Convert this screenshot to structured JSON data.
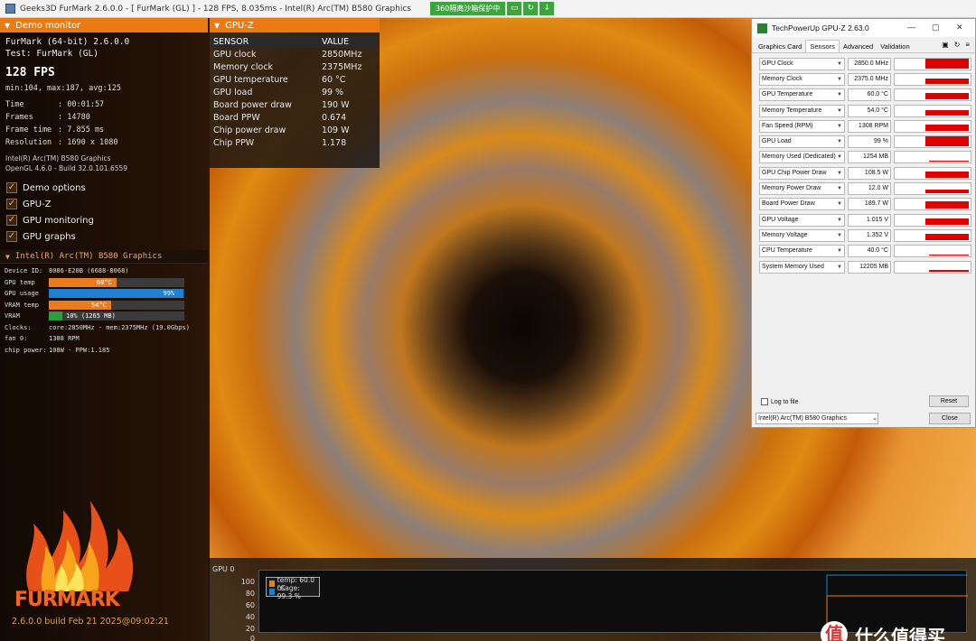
{
  "window": {
    "title": "Geeks3D FurMark 2.6.0.0 - [ FurMark (GL) ] - 128 FPS, 8.035ms - Intel(R) Arc(TM) B580 Graphics",
    "extension_label": "360隔离沙箱保护中"
  },
  "demo_monitor": {
    "header": "Demo monitor",
    "line1": "FurMark (64-bit) 2.6.0.0",
    "line2": "Test: FurMark (GL)",
    "fps": "128 FPS",
    "minmax": "min:104, max:187, avg:125",
    "stats": [
      {
        "k": "Time",
        "v": ": 00:01:57"
      },
      {
        "k": "Frames",
        "v": ": 14780"
      },
      {
        "k": "Frame time",
        "v": ": 7.855 ms"
      },
      {
        "k": "Resolution",
        "v": ": 1690 x 1080"
      }
    ],
    "gpu_name": "Intel(R) Arc(TM) B580 Graphics",
    "opengl": "OpenGL 4.6.0 - Build 32.0.101.6559",
    "options": [
      "Demo options",
      "GPU-Z",
      "GPU monitoring",
      "GPU graphs"
    ]
  },
  "gpu_section": {
    "header": "Intel(R) Arc(TM) B580 Graphics",
    "device_id_label": "Device ID:",
    "device_id": "8086-E20B (6688-8068)",
    "bars": [
      {
        "label": "GPU temp",
        "text": "60°C",
        "fraction": 0.5,
        "color": "#e87c1e"
      },
      {
        "label": "GPU usage",
        "text": "99%",
        "fraction": 0.99,
        "color": "#1f7fd0"
      },
      {
        "label": "VRAM temp",
        "text": "54°C",
        "fraction": 0.46,
        "color": "#e87c1e"
      },
      {
        "label": "VRAM",
        "text": "10% (1265 MB)",
        "fraction": 0.1,
        "color": "#2e9a3e"
      }
    ],
    "clocks_label": "Clocks:",
    "clocks": "core:2850MHz - mem:2375MHz (19.0Gbps)",
    "fan_label": "fan 0:",
    "fan": "1308 RPM",
    "chip_label": "chip power:",
    "chip": "108W - PPW:1.185"
  },
  "gpuz_panel": {
    "header": "GPU-Z",
    "col_sensor": "SENSOR",
    "col_value": "VALUE",
    "rows": [
      {
        "s": "GPU clock",
        "v": "2850MHz"
      },
      {
        "s": "Memory clock",
        "v": "2375MHz"
      },
      {
        "s": "GPU temperature",
        "v": "60 °C"
      },
      {
        "s": "GPU load",
        "v": "99 %"
      },
      {
        "s": "Board power draw",
        "v": "190 W"
      },
      {
        "s": "Board PPW",
        "v": "0.674"
      },
      {
        "s": "Chip power draw",
        "v": "109 W"
      },
      {
        "s": "Chip PPW",
        "v": "1.178"
      }
    ]
  },
  "logo": {
    "text": "FURMARK",
    "build": "2.6.0.0 build Feb 21 2025@09:02:21"
  },
  "graph": {
    "title": "GPU 0",
    "yticks": [
      "100",
      "80",
      "60",
      "40",
      "20",
      "0"
    ],
    "legend": [
      {
        "text": "temp: 60.0 °C",
        "color": "#e87c1e"
      },
      {
        "text": "usage: 99.3 %",
        "color": "#1f7fd0"
      }
    ]
  },
  "gpuz_window": {
    "title": "TechPowerUp GPU-Z 2.63.0",
    "tabs": [
      "Graphics Card",
      "Sensors",
      "Advanced",
      "Validation"
    ],
    "active_tab": "Sensors",
    "sensors": [
      {
        "name": "GPU Clock",
        "value": "2850.0 MHz",
        "level": 0.9
      },
      {
        "name": "Memory Clock",
        "value": "2375.0 MHz",
        "level": 0.5
      },
      {
        "name": "GPU Temperature",
        "value": "60.0 °C",
        "level": 0.6
      },
      {
        "name": "Memory Temperature",
        "value": "54.0 °C",
        "level": 0.5
      },
      {
        "name": "Fan Speed (RPM)",
        "value": "1308 RPM",
        "level": 0.55
      },
      {
        "name": "GPU Load",
        "value": "99 %",
        "level": 0.95
      },
      {
        "name": "Memory Used (Dedicated)",
        "value": "1254 MB",
        "level": 0.05
      },
      {
        "name": "GPU Chip Power Draw",
        "value": "108.5 W",
        "level": 0.6
      },
      {
        "name": "Memory Power Draw",
        "value": "12.0 W",
        "level": 0.3
      },
      {
        "name": "Board Power Draw",
        "value": "189.7 W",
        "level": 0.7
      },
      {
        "name": "GPU Voltage",
        "value": "1.015 V",
        "level": 0.6
      },
      {
        "name": "Memory Voltage",
        "value": "1.352 V",
        "level": 0.6
      },
      {
        "name": "CPU Temperature",
        "value": "40.0 °C",
        "level": 0.12
      },
      {
        "name": "System Memory Used",
        "value": "12205 MB",
        "level": 0.15
      }
    ],
    "log_label": "Log to file",
    "reset_label": "Reset",
    "device_select": "Intel(R) Arc(TM) B580 Graphics",
    "close_label": "Close"
  },
  "watermark": {
    "text": "什么值得买",
    "logo_glyph": "值"
  }
}
